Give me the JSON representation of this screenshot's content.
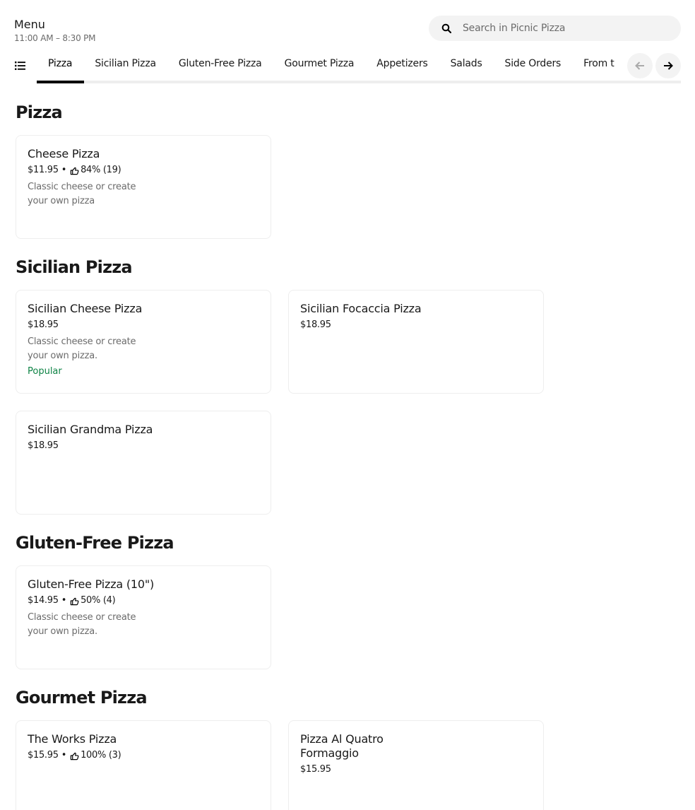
{
  "header": {
    "title": "Menu",
    "hours": "11:00 AM – 8:30 PM"
  },
  "search": {
    "placeholder": "Search in Picnic Pizza",
    "icon": "search-icon"
  },
  "tabs": [
    {
      "label": "Pizza",
      "active": true
    },
    {
      "label": "Sicilian Pizza"
    },
    {
      "label": "Gluten-Free Pizza"
    },
    {
      "label": "Gourmet Pizza"
    },
    {
      "label": "Appetizers"
    },
    {
      "label": "Salads"
    },
    {
      "label": "Side Orders"
    },
    {
      "label": "From t"
    }
  ],
  "colors": {
    "popular": "#0e8345",
    "muted_text": "#6b6b6b",
    "active_indicator": "#000000"
  },
  "sections": [
    {
      "title": "Pizza",
      "items": [
        {
          "name": "Cheese Pizza",
          "price": "$11.95",
          "sep": "•",
          "rating": "84% (19)",
          "desc": "Classic cheese or create your own pizza"
        }
      ]
    },
    {
      "title": "Sicilian Pizza",
      "items": [
        {
          "name": "Sicilian Cheese Pizza",
          "price": "$18.95",
          "desc": "Classic cheese or create your own pizza.",
          "badge": "Popular"
        },
        {
          "name": "Sicilian Focaccia Pizza",
          "price": "$18.95"
        },
        {
          "name": "Sicilian Grandma Pizza",
          "price": "$18.95"
        }
      ]
    },
    {
      "title": "Gluten-Free Pizza",
      "items": [
        {
          "name": "Gluten-Free Pizza (10\")",
          "price": "$14.95",
          "sep": "•",
          "rating": "50% (4)",
          "desc": "Classic cheese or create your own pizza."
        }
      ]
    },
    {
      "title": "Gourmet Pizza",
      "items": [
        {
          "name": "The Works Pizza",
          "price": "$15.95",
          "sep": "•",
          "rating": "100% (3)"
        },
        {
          "name": "Pizza Al Quatro Formaggio",
          "price": "$15.95"
        }
      ]
    }
  ]
}
